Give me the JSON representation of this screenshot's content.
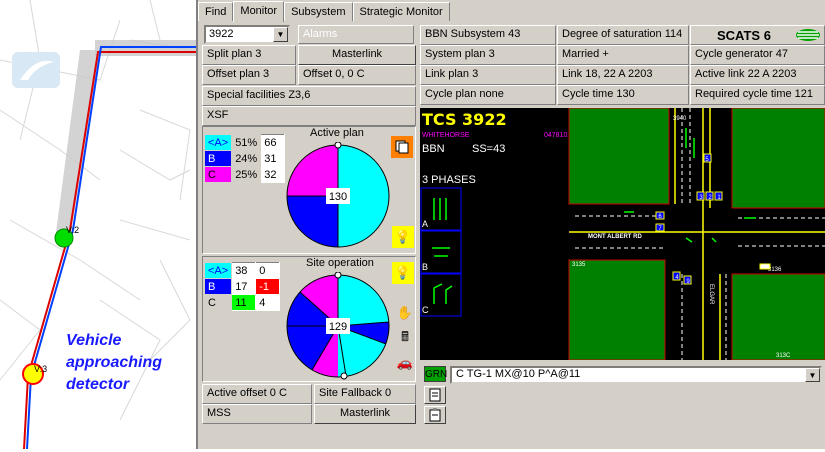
{
  "map": {
    "detector_2": "V:2",
    "detector_3": "V:3",
    "annotation_lines": [
      "Vehicle",
      "approaching",
      "detector"
    ]
  },
  "tabs": [
    "Find",
    "Monitor",
    "Subsystem",
    "Strategic Monitor"
  ],
  "site": {
    "selector": "3922",
    "alarms": "Alarms",
    "split_plan": "Split plan 3",
    "masterlink_button": "Masterlink",
    "offset_plan": "Offset plan 3",
    "offset": "Offset 0, 0 C",
    "special_facilities": "Special facilities  Z3,6",
    "xsf": "XSF"
  },
  "subsystem": {
    "bbn": "BBN Subsystem 43",
    "degree": "Degree of saturation 114",
    "scats": "SCATS 6",
    "system_plan": "System plan 3",
    "married": "Married +",
    "cycle_generator": "Cycle generator   47",
    "link_plan": "Link plan 3",
    "link": "Link 18, 22 A 2203",
    "active_link": "Active link 22 A 2203",
    "cycle_plan": "Cycle plan none",
    "cycle_time": "Cycle time 130",
    "required_cycle": "Required cycle time 121"
  },
  "active_plan": {
    "title": "Active plan",
    "cycle": "130",
    "rows": [
      {
        "phase": "<A>",
        "pct": "51%",
        "val": "66"
      },
      {
        "phase": "B",
        "pct": "24%",
        "val": "31"
      },
      {
        "phase": "C",
        "pct": "25%",
        "val": "32"
      }
    ]
  },
  "site_operation": {
    "title": "Site operation",
    "cycle": "129",
    "rows": [
      {
        "phase": "<A>",
        "a": "38",
        "b": "0"
      },
      {
        "phase": "B",
        "a": "17",
        "b": "-1"
      },
      {
        "phase": "C",
        "a": "11",
        "b": "4"
      }
    ]
  },
  "footer": {
    "active_offset": "Active offset 0 C",
    "site_fallback": "Site Fallback 0",
    "mss": "MSS",
    "masterlink": "Masterlink"
  },
  "tcs": {
    "title": "TCS 3922",
    "suburb": "WHITEHORSE",
    "code": "047810",
    "bbn": "BBN",
    "ss": "SS=43",
    "phases_label": "3 PHASES",
    "phase_labels": [
      "A",
      "B",
      "C"
    ],
    "street_ew": "MONT ALBERT RD",
    "street_ns": "ELGAR",
    "det_tl": "3940",
    "det_l": "3135",
    "det_r": "3136",
    "det_b": "313C",
    "det_lanes": [
      "5",
      "3",
      "2",
      "1",
      "6",
      "7",
      "4",
      "9",
      "8"
    ]
  },
  "signal": {
    "state": "GRN",
    "text": "C TG-1 MX@10 P^A@11"
  },
  "colors": {
    "A": "#00ffff",
    "B": "#0000ff",
    "C": "#ff00ff",
    "green_block": "#008000",
    "window": "#d4d0c8"
  }
}
